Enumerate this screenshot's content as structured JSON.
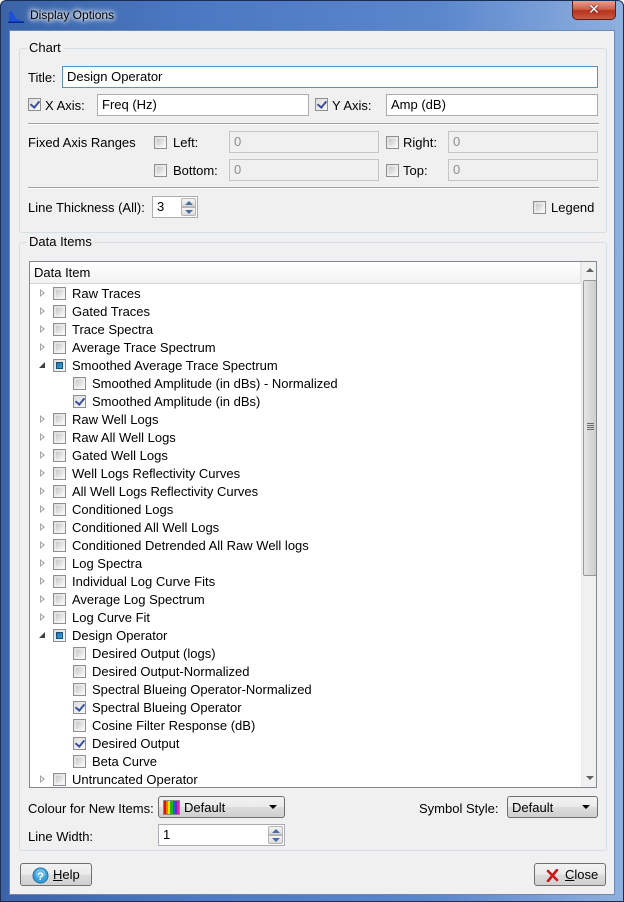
{
  "window": {
    "title": "Display Options",
    "close_glyph": "✕"
  },
  "chart_group": {
    "legend": "Chart",
    "title_label": "Title:",
    "title_value": "Design Operator",
    "x_axis": {
      "label": "X Axis:",
      "checked": true,
      "value": "Freq (Hz)"
    },
    "y_axis": {
      "label": "Y Axis:",
      "checked": true,
      "value": "Amp (dB)"
    },
    "fixed_axis_ranges_label": "Fixed Axis Ranges",
    "ranges": {
      "left": {
        "label": "Left:",
        "checked": false,
        "value": "0"
      },
      "right": {
        "label": "Right:",
        "checked": false,
        "value": "0"
      },
      "bottom": {
        "label": "Bottom:",
        "checked": false,
        "value": "0"
      },
      "top": {
        "label": "Top:",
        "checked": false,
        "value": "0"
      }
    },
    "line_thickness_label": "Line Thickness (All):",
    "line_thickness_value": "3",
    "legend_label": "Legend",
    "legend_checked": false
  },
  "data_items_group": {
    "legend": "Data Items",
    "column_header": "Data Item",
    "rows": [
      {
        "label": "Raw Traces",
        "level": 0,
        "expander": "collapsed",
        "state": "unchecked"
      },
      {
        "label": "Gated Traces",
        "level": 0,
        "expander": "collapsed",
        "state": "unchecked"
      },
      {
        "label": "Trace Spectra",
        "level": 0,
        "expander": "collapsed",
        "state": "unchecked"
      },
      {
        "label": "Average Trace Spectrum",
        "level": 0,
        "expander": "collapsed",
        "state": "unchecked"
      },
      {
        "label": "Smoothed Average Trace Spectrum",
        "level": 0,
        "expander": "expanded",
        "state": "partial"
      },
      {
        "label": "Smoothed Amplitude (in dBs) - Normalized",
        "level": 1,
        "expander": "none",
        "state": "unchecked"
      },
      {
        "label": "Smoothed Amplitude (in dBs)",
        "level": 1,
        "expander": "none",
        "state": "checked"
      },
      {
        "label": "Raw Well Logs",
        "level": 0,
        "expander": "collapsed",
        "state": "unchecked"
      },
      {
        "label": "Raw All Well Logs",
        "level": 0,
        "expander": "collapsed",
        "state": "unchecked"
      },
      {
        "label": "Gated Well Logs",
        "level": 0,
        "expander": "collapsed",
        "state": "unchecked"
      },
      {
        "label": "Well Logs Reflectivity Curves",
        "level": 0,
        "expander": "collapsed",
        "state": "unchecked"
      },
      {
        "label": "All Well Logs Reflectivity Curves",
        "level": 0,
        "expander": "collapsed",
        "state": "unchecked"
      },
      {
        "label": "Conditioned Logs",
        "level": 0,
        "expander": "collapsed",
        "state": "unchecked"
      },
      {
        "label": "Conditioned All Well Logs",
        "level": 0,
        "expander": "collapsed",
        "state": "unchecked"
      },
      {
        "label": "Conditioned Detrended All Raw Well logs",
        "level": 0,
        "expander": "collapsed",
        "state": "unchecked"
      },
      {
        "label": "Log Spectra",
        "level": 0,
        "expander": "collapsed",
        "state": "unchecked"
      },
      {
        "label": "Individual Log Curve Fits",
        "level": 0,
        "expander": "collapsed",
        "state": "unchecked"
      },
      {
        "label": "Average Log Spectrum",
        "level": 0,
        "expander": "collapsed",
        "state": "unchecked"
      },
      {
        "label": "Log Curve Fit",
        "level": 0,
        "expander": "collapsed",
        "state": "unchecked"
      },
      {
        "label": "Design Operator",
        "level": 0,
        "expander": "expanded",
        "state": "partial"
      },
      {
        "label": "Desired Output (logs)",
        "level": 1,
        "expander": "none",
        "state": "unchecked"
      },
      {
        "label": "Desired Output-Normalized",
        "level": 1,
        "expander": "none",
        "state": "unchecked"
      },
      {
        "label": "Spectral Blueing Operator-Normalized",
        "level": 1,
        "expander": "none",
        "state": "unchecked"
      },
      {
        "label": "Spectral Blueing Operator",
        "level": 1,
        "expander": "none",
        "state": "checked"
      },
      {
        "label": "Cosine Filter Response (dB)",
        "level": 1,
        "expander": "none",
        "state": "unchecked"
      },
      {
        "label": "Desired Output",
        "level": 1,
        "expander": "none",
        "state": "checked"
      },
      {
        "label": "Beta Curve",
        "level": 1,
        "expander": "none",
        "state": "unchecked"
      },
      {
        "label": "Untruncated Operator",
        "level": 0,
        "expander": "collapsed",
        "state": "unchecked"
      }
    ],
    "colour_label": "Colour for New Items:",
    "colour_value": "Default",
    "colour_swatch": [
      "#e01010",
      "#f07a00",
      "#f0e000",
      "#20b020",
      "#1a5fe0",
      "#8020c0",
      "#e020a0"
    ],
    "symbol_style_label": "Symbol Style:",
    "symbol_style_value": "Default",
    "line_width_label": "Line Width:",
    "line_width_value": "1"
  },
  "footer": {
    "help_label": "Help",
    "help_mnemonic": "H",
    "help_rest": "elp",
    "close_label": "Close",
    "close_mnemonic": "C",
    "close_rest": "lose"
  }
}
